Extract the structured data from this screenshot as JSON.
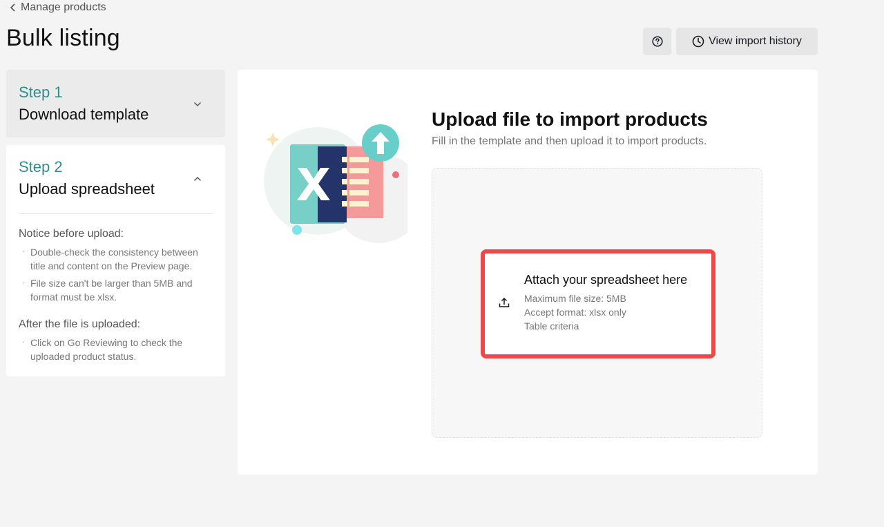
{
  "header": {
    "breadcrumb": "Manage products",
    "title": "Bulk listing",
    "view_history_label": "View import history"
  },
  "steps": [
    {
      "number": "Step 1",
      "name": "Download template",
      "expanded": false
    },
    {
      "number": "Step 2",
      "name": "Upload spreadsheet",
      "expanded": true
    }
  ],
  "notice": {
    "before_heading": "Notice before upload:",
    "before_items": [
      "Double-check the consistency between title and content on the Preview page.",
      "File size can't be larger than 5MB and format must be xlsx."
    ],
    "after_heading": "After the file is uploaded:",
    "after_items": [
      "Click on Go Reviewing to check the uploaded product status."
    ]
  },
  "upload": {
    "title": "Upload file to import products",
    "subtitle": "Fill in the template and then upload it to import products.",
    "attach_title": "Attach your spreadsheet here",
    "max_size": "Maximum file size: 5MB",
    "format": "Accept format: xlsx only",
    "criteria": "Table criteria"
  },
  "icons": {
    "back": "chevron-left-icon",
    "help": "question-circle-icon",
    "history": "clock-icon",
    "collapse": "chevron-down-icon",
    "expand": "chevron-up-icon",
    "upload": "upload-icon",
    "illustration": "excel-upload-illustration"
  },
  "colors": {
    "accent_teal": "#2f8f8d",
    "highlight_red": "#f04848",
    "background": "#f4f4f4"
  }
}
